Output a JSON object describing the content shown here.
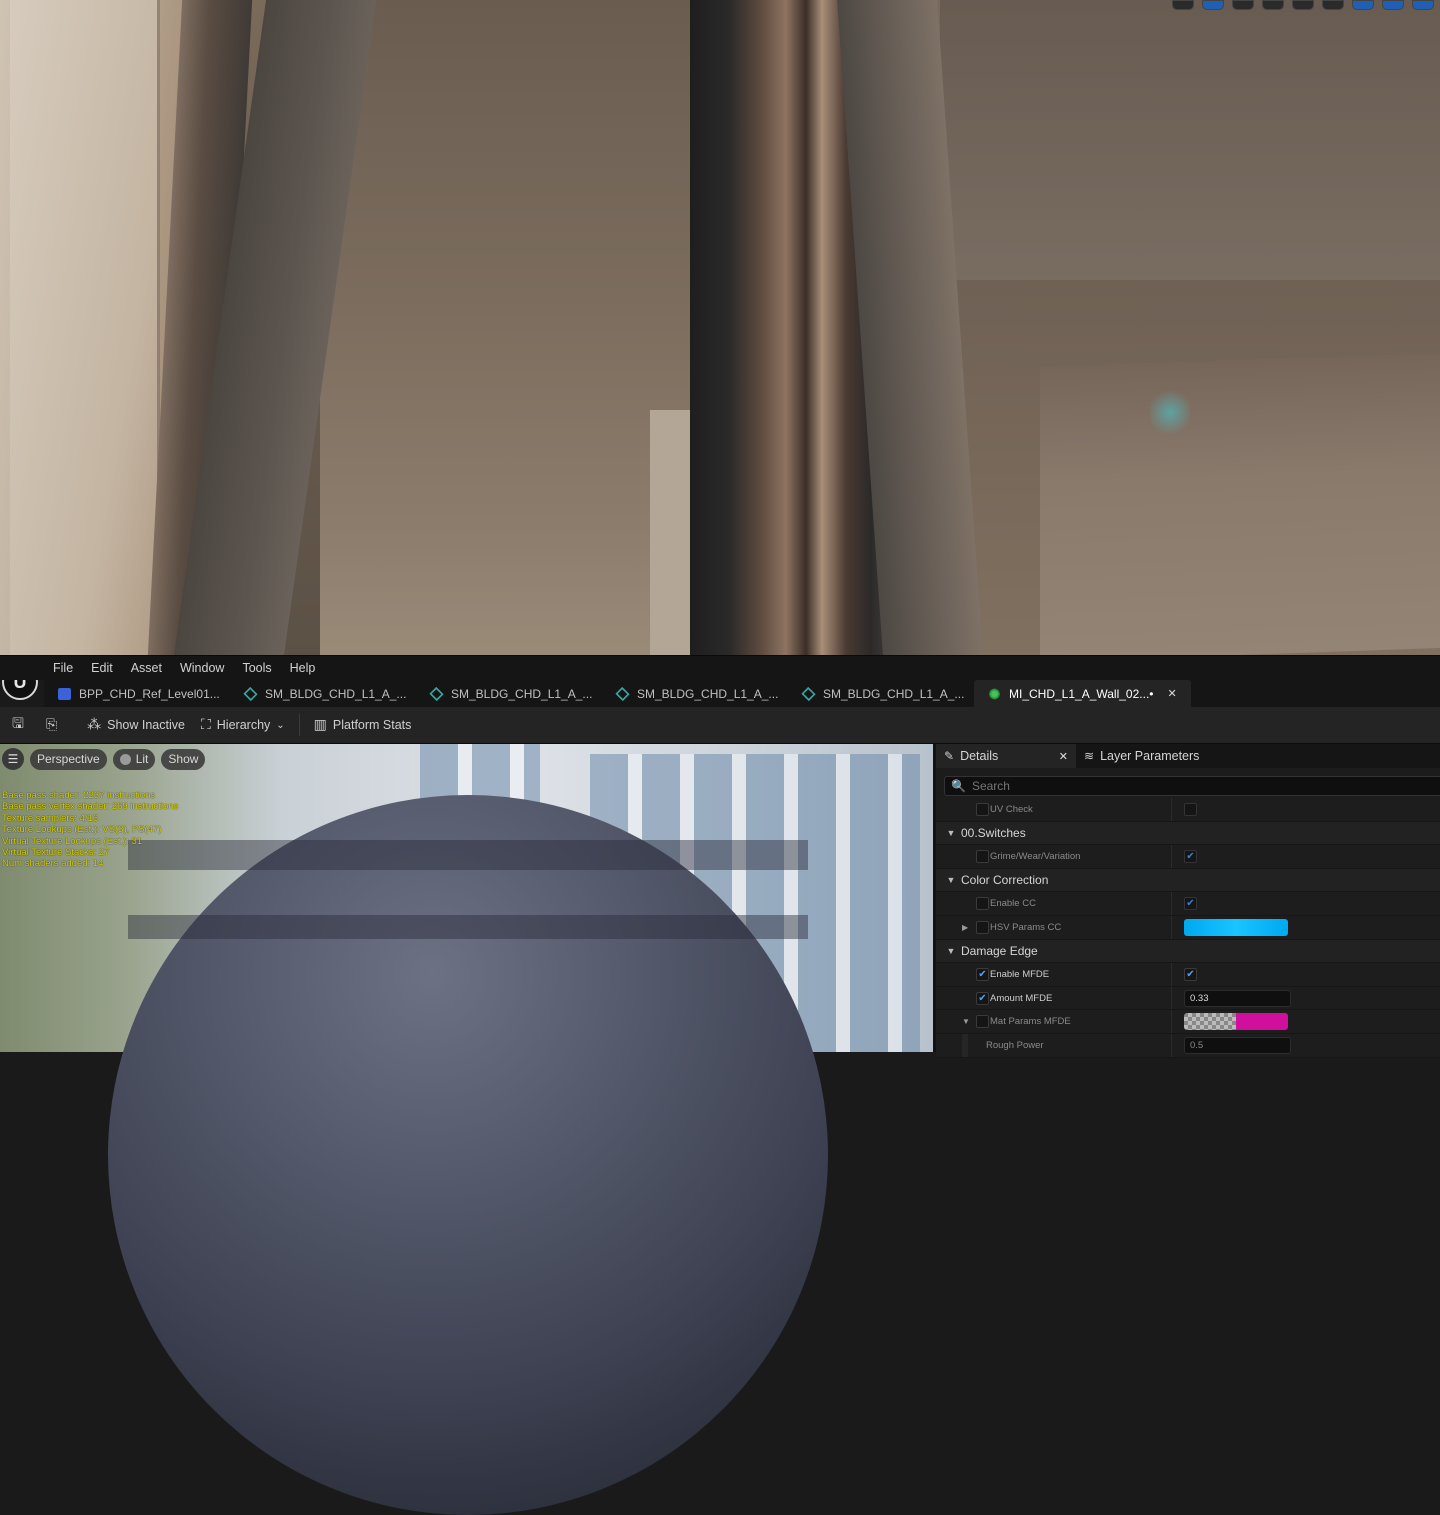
{
  "menu": [
    "File",
    "Edit",
    "Asset",
    "Window",
    "Tools",
    "Help"
  ],
  "tabs": [
    {
      "label": "BPP_CHD_Ref_Level01...",
      "icon": "blueprint-icon"
    },
    {
      "label": "SM_BLDG_CHD_L1_A_...",
      "icon": "static-mesh-icon"
    },
    {
      "label": "SM_BLDG_CHD_L1_A_...",
      "icon": "static-mesh-icon"
    },
    {
      "label": "SM_BLDG_CHD_L1_A_...",
      "icon": "static-mesh-icon"
    },
    {
      "label": "SM_BLDG_CHD_L1_A_...",
      "icon": "static-mesh-icon"
    },
    {
      "label": "MI_CHD_L1_A_Wall_02...•",
      "icon": "material-instance-icon",
      "active": true
    }
  ],
  "toolbar": {
    "show_inactive": "Show Inactive",
    "hierarchy": "Hierarchy",
    "platform_stats": "Platform Stats"
  },
  "preview": {
    "perspective": "Perspective",
    "lit": "Lit",
    "show": "Show",
    "stats": [
      "Base pass shader: 2237 instructions",
      "Base pass vertex shader: 269 instructions",
      "Texture samplers: 4/16",
      "Texture Lookups (Est.): VS(3), PS(47)",
      "Virtual Texture Lookups (Est.): 31",
      "Virtual Texture Stacks: 27",
      "Num shaders added: 14"
    ]
  },
  "details": {
    "tab_details": "Details",
    "tab_layer_params": "Layer Parameters",
    "search_placeholder": "Search",
    "rows": [
      {
        "kind": "prop",
        "label": "UV Check",
        "override": false,
        "value_type": "checkbox",
        "value": false
      },
      {
        "kind": "cat",
        "label": "00.Switches"
      },
      {
        "kind": "prop",
        "label": "Grime/Wear/Variation",
        "override": false,
        "value_type": "checkbox",
        "value": true
      },
      {
        "kind": "cat",
        "label": "Color Correction"
      },
      {
        "kind": "prop",
        "label": "Enable CC",
        "override": false,
        "value_type": "checkbox",
        "value": true
      },
      {
        "kind": "prop",
        "label": "HSV Params CC",
        "override": false,
        "value_type": "color",
        "expandable": true
      },
      {
        "kind": "cat",
        "label": "Damage Edge"
      },
      {
        "kind": "prop",
        "label": "Enable MFDE",
        "override": true,
        "value_type": "checkbox",
        "value": true
      },
      {
        "kind": "prop",
        "label": "Amount MFDE",
        "override": true,
        "value_type": "number",
        "value": "0.33"
      },
      {
        "kind": "prop",
        "label": "Mat Params MFDE",
        "override": false,
        "value_type": "split-color",
        "expandable": true,
        "expanded": true
      },
      {
        "kind": "prop",
        "label": "Rough Power",
        "override": false,
        "value_type": "number",
        "value": "0.5",
        "nested": true
      }
    ]
  },
  "colors": {
    "accent": "#1f5fb5",
    "checkbox": "#4aa0ff",
    "hsv_color": "#19c4ff",
    "mat_params_color": "#d0109c",
    "stats_text": "#d8d000"
  }
}
